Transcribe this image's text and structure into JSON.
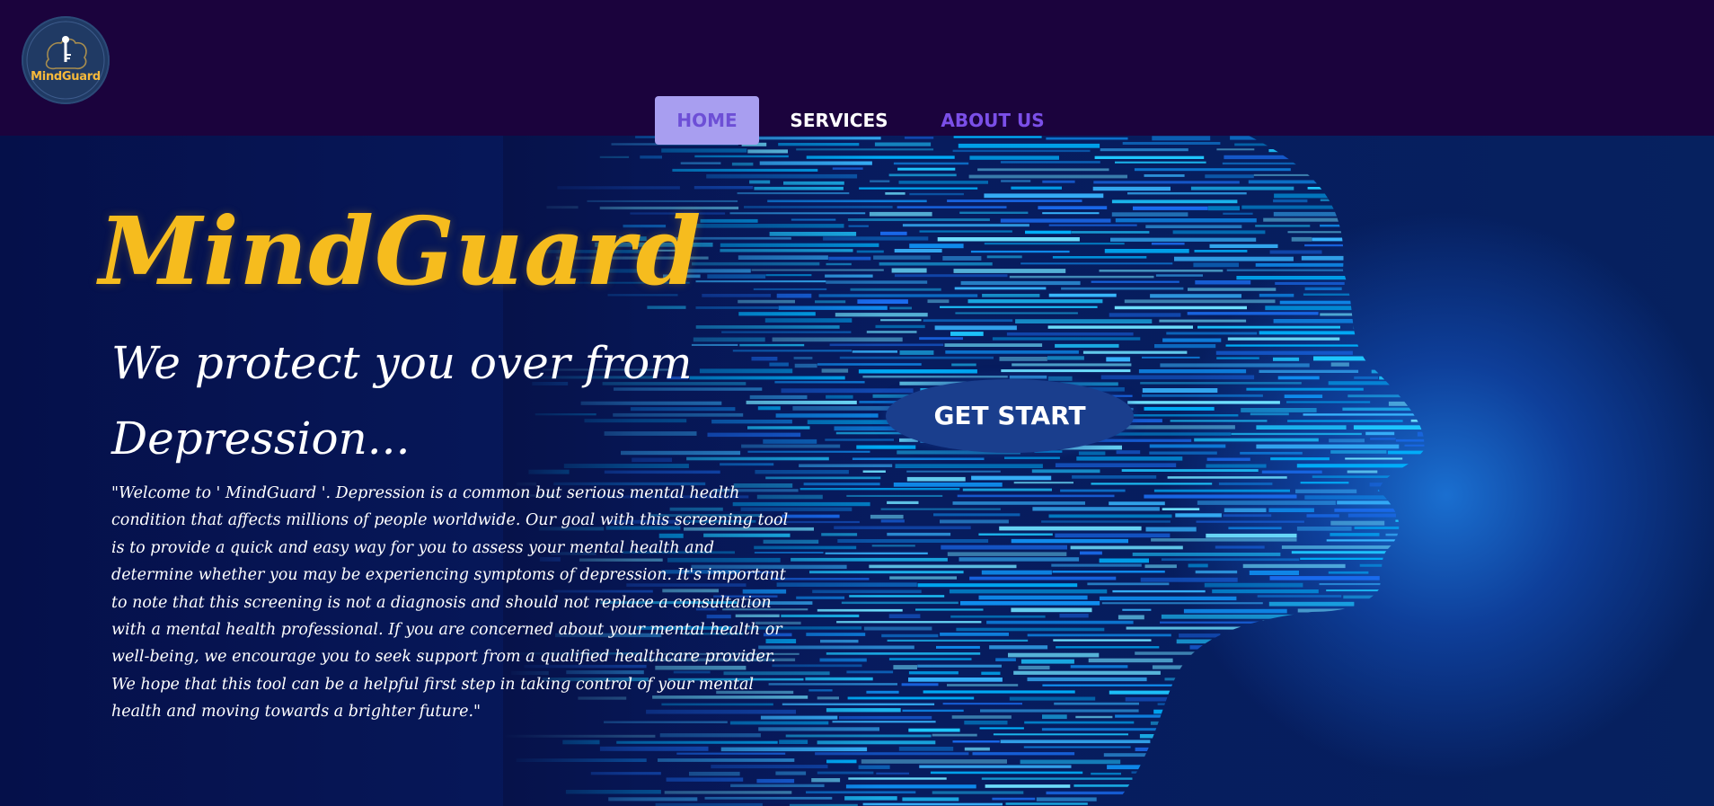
{
  "header": {
    "logo_text": "MindGuard",
    "logo_icon": "brain-key-icon"
  },
  "nav": {
    "items": [
      {
        "label": "HOME",
        "active": true
      },
      {
        "label": "SERVICES",
        "active": false
      },
      {
        "label": "ABOUT US",
        "active": false
      }
    ]
  },
  "hero": {
    "title": "MindGuard",
    "tagline_line1": "We protect you over from",
    "tagline_line2": "Depression...",
    "intro": "\"Welcome to ' MindGuard '. Depression is a common but serious mental health condition that affects millions of people worldwide. Our goal with this screening tool is to provide a quick and easy way for you to assess your mental health and determine whether you may be experiencing symptoms of depression. It's important to note that this screening is not a diagnosis and should not replace a consultation with a mental health professional. If you are concerned about your mental health or well-being, we encourage you to seek support from a qualified healthcare provider. We hope that this tool can be a helpful first step in taking control of your mental health and moving towards a brighter future.\"",
    "cta_label": "GET START",
    "background_art": "digital-face-profile-image"
  },
  "colors": {
    "topbar": "#1b033d",
    "hero_bg": "#06124a",
    "brand_yellow": "#f6bc1e",
    "nav_active_bg": "#a89ef0",
    "nav_active_text": "#6d4fd6",
    "nav_about_text": "#7b4fe8",
    "cta_bg": "#1a3e8d"
  }
}
